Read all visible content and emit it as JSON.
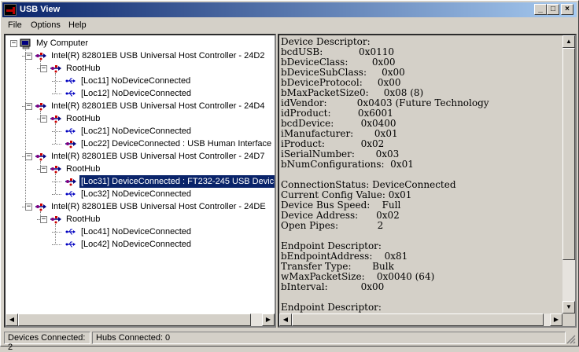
{
  "window": {
    "title": "USB View"
  },
  "menu": [
    {
      "label": "File"
    },
    {
      "label": "Options"
    },
    {
      "label": "Help"
    }
  ],
  "tree": [
    {
      "label": "My Computer",
      "icon": "computer-icon"
    },
    {
      "label": "Intel(R) 82801EB USB Universal Host Controller - 24D2",
      "icon": "usb-controller-icon"
    },
    {
      "label": "RootHub",
      "icon": "usb-hub-icon"
    },
    {
      "label": "[Loc11] NoDeviceConnected",
      "icon": "usb-port-icon"
    },
    {
      "label": "[Loc12] NoDeviceConnected",
      "icon": "usb-port-icon"
    },
    {
      "label": "Intel(R) 82801EB USB Universal Host Controller - 24D4",
      "icon": "usb-controller-icon"
    },
    {
      "label": "RootHub",
      "icon": "usb-hub-icon"
    },
    {
      "label": "[Loc21] NoDeviceConnected",
      "icon": "usb-port-icon"
    },
    {
      "label": "[Loc22] DeviceConnected :  USB Human Interface",
      "icon": "usb-device-icon"
    },
    {
      "label": "Intel(R) 82801EB USB Universal Host Controller - 24D7",
      "icon": "usb-controller-icon"
    },
    {
      "label": "RootHub",
      "icon": "usb-hub-icon"
    },
    {
      "label": "[Loc31] DeviceConnected :  FT232-245 USB Devic",
      "icon": "usb-device-icon"
    },
    {
      "label": "[Loc32] NoDeviceConnected",
      "icon": "usb-port-icon"
    },
    {
      "label": "Intel(R) 82801EB USB Universal Host Controller - 24DE",
      "icon": "usb-controller-icon"
    },
    {
      "label": "RootHub",
      "icon": "usb-hub-icon"
    },
    {
      "label": "[Loc41] NoDeviceConnected",
      "icon": "usb-port-icon"
    },
    {
      "label": "[Loc42] NoDeviceConnected",
      "icon": "usb-port-icon"
    }
  ],
  "selected_item": "[Loc31] DeviceConnected :  FT232-245 USB Devic",
  "details": [
    "Device Descriptor:",
    "bcdUSB:            0x0110",
    "bDeviceClass:        0x00",
    "bDeviceSubClass:     0x00",
    "bDeviceProtocol:     0x00",
    "bMaxPacketSize0:     0x08 (8)",
    "idVendor:          0x0403 (Future Technology",
    "idProduct:         0x6001",
    "bcdDevice:         0x0400",
    "iManufacturer:       0x01",
    "iProduct:            0x02",
    "iSerialNumber:       0x03",
    "bNumConfigurations:  0x01",
    "",
    "ConnectionStatus: DeviceConnected",
    "Current Config Value: 0x01",
    "Device Bus Speed:    Full",
    "Device Address:      0x02",
    "Open Pipes:             2",
    "",
    "Endpoint Descriptor:",
    "bEndpointAddress:    0x81",
    "Transfer Type:       Bulk",
    "wMaxPacketSize:    0x0040 (64)",
    "bInterval:           0x00",
    "",
    "Endpoint Descriptor:"
  ],
  "status": {
    "devices": "Devices Connected: 2",
    "hubs": "Hubs Connected: 0"
  },
  "colors": {
    "selection": "#0a246a",
    "face": "#d4d0c8",
    "titlebar_start": "#0a246a",
    "titlebar_end": "#a6caf0"
  }
}
